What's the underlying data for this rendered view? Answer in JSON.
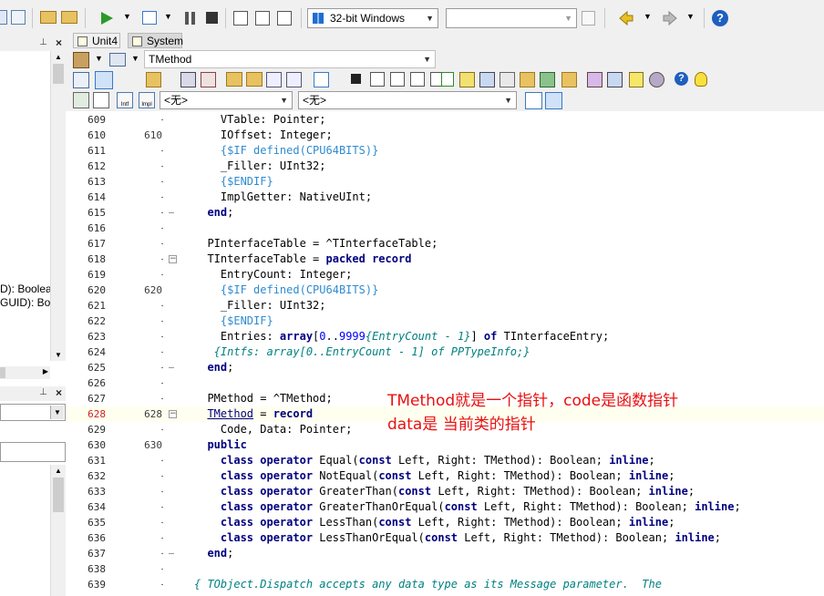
{
  "toolbar": {
    "platform": "32-bit Windows",
    "config": ""
  },
  "tabs": [
    {
      "label": "Unit4"
    },
    {
      "label": "System"
    }
  ],
  "class_combo": "TMethod",
  "nav_left": "<无>",
  "nav_right": "<无>",
  "left_panel": {
    "line1": "D): Boolean",
    "line2": "GUID): Boo"
  },
  "annotation": {
    "line1": "TMethod就是一个指针，code是函数指针",
    "line2": "data是 当前类的指针"
  },
  "code_lines": [
    {
      "n": "609",
      "m": "",
      "html": "    VTable: Pointer;"
    },
    {
      "n": "610",
      "m": "610",
      "html": "    IOffset: Integer;"
    },
    {
      "n": "611",
      "m": "",
      "html": "    <span class=\"dir\">{$IF defined(CPU64BITS)}</span>"
    },
    {
      "n": "612",
      "m": "",
      "html": "    _Filler: UInt32;"
    },
    {
      "n": "613",
      "m": "",
      "html": "    <span class=\"dir\">{$ENDIF}</span>"
    },
    {
      "n": "614",
      "m": "",
      "html": "    ImplGetter: NativeUInt;"
    },
    {
      "n": "615",
      "m": "",
      "html": "  <span class=\"kw\">end</span>;",
      "fe": true
    },
    {
      "n": "616",
      "m": "",
      "html": ""
    },
    {
      "n": "617",
      "m": "",
      "html": "  PInterfaceTable = ^TInterfaceTable;"
    },
    {
      "n": "618",
      "m": "",
      "html": "  TInterfaceTable = <span class=\"kw\">packed record</span>",
      "fold": true
    },
    {
      "n": "619",
      "m": "",
      "html": "    EntryCount: Integer;"
    },
    {
      "n": "620",
      "m": "620",
      "html": "    <span class=\"dir\">{$IF defined(CPU64BITS)}</span>"
    },
    {
      "n": "621",
      "m": "",
      "html": "    _Filler: UInt32;"
    },
    {
      "n": "622",
      "m": "",
      "html": "    <span class=\"dir\">{$ENDIF}</span>"
    },
    {
      "n": "623",
      "m": "",
      "html": "    Entries: <span class=\"kw\">array</span>[<span class=\"num\">0</span>..<span class=\"num\">9999</span><span class=\"cm\">{EntryCount - 1}</span>] <span class=\"kw\">of</span> TInterfaceEntry;"
    },
    {
      "n": "624",
      "m": "",
      "html": "   <span class=\"cm\">{Intfs: array[0..EntryCount - 1] of PPTypeInfo;}</span>"
    },
    {
      "n": "625",
      "m": "",
      "html": "  <span class=\"kw\">end</span>;",
      "fe": true
    },
    {
      "n": "626",
      "m": "",
      "html": ""
    },
    {
      "n": "627",
      "m": "",
      "html": "  PMethod = ^TMethod;"
    },
    {
      "n": "628",
      "m": "628",
      "html": "  <span style=\"text-decoration:underline;color:#000080\">TMethod</span> = <span class=\"kw\">record</span>",
      "fold": true,
      "cur": true
    },
    {
      "n": "629",
      "m": "",
      "html": "    Code, Data: Pointer;"
    },
    {
      "n": "630",
      "m": "630",
      "html": "  <span class=\"kw\">public</span>"
    },
    {
      "n": "631",
      "m": "",
      "html": "    <span class=\"kw\">class operator</span> Equal(<span class=\"kw\">const</span> Left, Right: TMethod): Boolean; <span class=\"kw\">inline</span>;"
    },
    {
      "n": "632",
      "m": "",
      "html": "    <span class=\"kw\">class operator</span> NotEqual(<span class=\"kw\">const</span> Left, Right: TMethod): Boolean; <span class=\"kw\">inline</span>;"
    },
    {
      "n": "633",
      "m": "",
      "html": "    <span class=\"kw\">class operator</span> GreaterThan(<span class=\"kw\">const</span> Left, Right: TMethod): Boolean; <span class=\"kw\">inline</span>;"
    },
    {
      "n": "634",
      "m": "",
      "html": "    <span class=\"kw\">class operator</span> GreaterThanOrEqual(<span class=\"kw\">const</span> Left, Right: TMethod): Boolean; <span class=\"kw\">inline</span>;"
    },
    {
      "n": "635",
      "m": "",
      "html": "    <span class=\"kw\">class operator</span> LessThan(<span class=\"kw\">const</span> Left, Right: TMethod): Boolean; <span class=\"kw\">inline</span>;"
    },
    {
      "n": "636",
      "m": "",
      "html": "    <span class=\"kw\">class operator</span> LessThanOrEqual(<span class=\"kw\">const</span> Left, Right: TMethod): Boolean; <span class=\"kw\">inline</span>;"
    },
    {
      "n": "637",
      "m": "",
      "html": "  <span class=\"kw\">end</span>;",
      "fe": true
    },
    {
      "n": "638",
      "m": "",
      "html": ""
    },
    {
      "n": "639",
      "m": "",
      "html": "<span class=\"cm\">{ TObject.Dispatch accepts any data type as its Message parameter.  The</span>"
    }
  ]
}
